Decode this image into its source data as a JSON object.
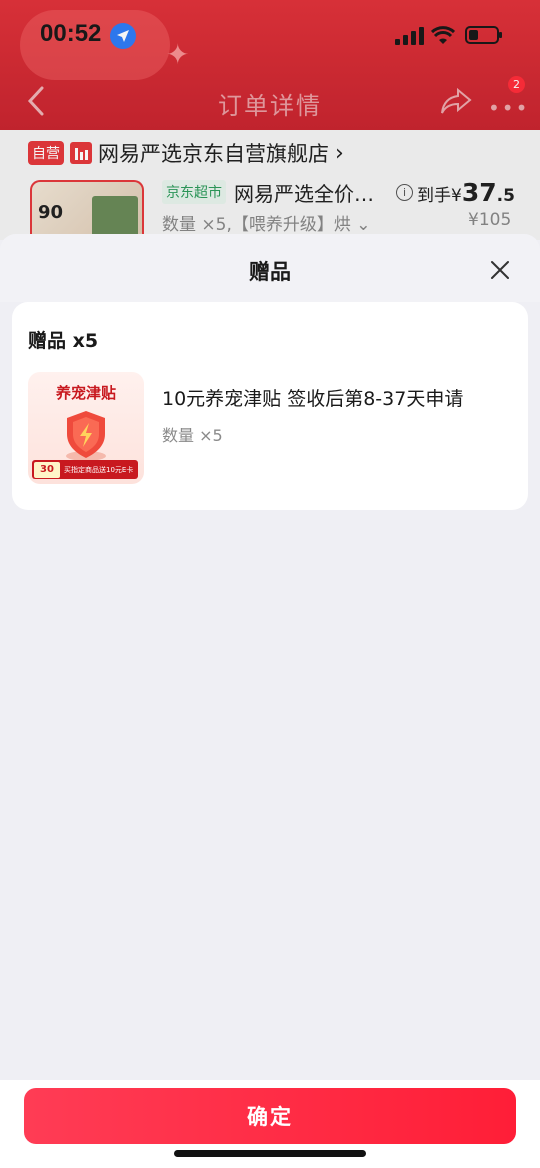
{
  "status_bar": {
    "time": "00:52"
  },
  "nav": {
    "title": "订单详情",
    "more_badge": "2"
  },
  "order": {
    "self_tag": "自营",
    "store_name": "网易严选京东自营旗舰店",
    "store_chevron": "›",
    "thumb_text": "90",
    "channel_tag": "京东超市",
    "product_name": "网易严选全价…",
    "price_label": "到手¥",
    "price_int": "37",
    "price_dec": ".5",
    "qty_spec": "数量 ×5,【喂养升级】烘 ⌄",
    "orig_price": "¥105"
  },
  "sheet": {
    "title": "赠品",
    "section_title": "赠品 x5",
    "gift": {
      "thumb_title": "养宠津贴",
      "thumb_badge": "30",
      "thumb_band_text": "买指定商品送10元E卡",
      "name": "10元养宠津贴 签收后第8-37天申请",
      "qty": "数量 ×5"
    }
  },
  "confirm_label": "确定",
  "colors": {
    "brand_red": "#e4393c",
    "button_red": "#ff1e37",
    "jd_green": "#2c9b5b"
  }
}
